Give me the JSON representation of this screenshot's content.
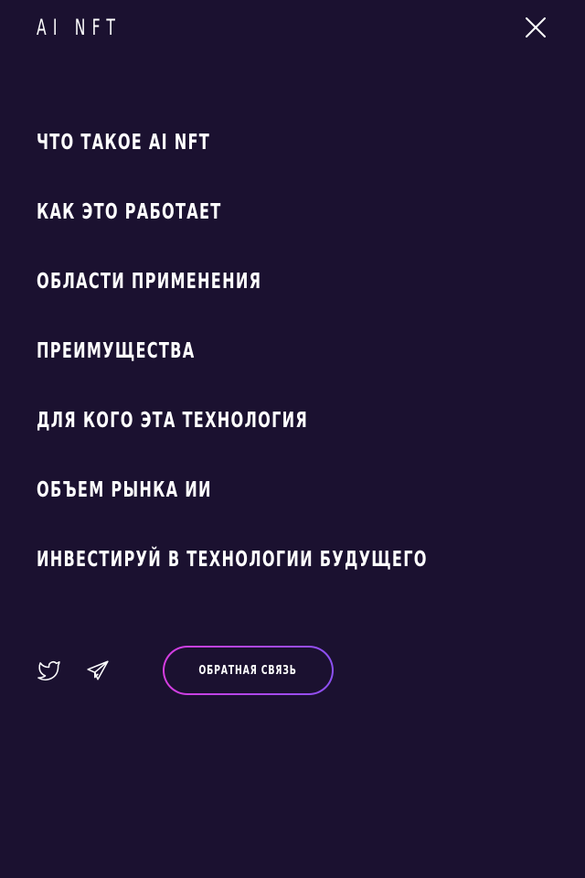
{
  "header": {
    "logo_text": "AI NFT",
    "close_icon": "close-icon"
  },
  "nav": {
    "items": [
      {
        "label": "ЧТО ТАКОЕ AI NFT"
      },
      {
        "label": "КАК ЭТО РАБОТАЕТ"
      },
      {
        "label": "ОБЛАСТИ ПРИМЕНЕНИЯ"
      },
      {
        "label": "ПРЕИМУЩЕСТВА"
      },
      {
        "label": "ДЛЯ КОГО ЭТА ТЕХНОЛОГИЯ"
      },
      {
        "label": "ОБЪЕМ РЫНКА ИИ"
      },
      {
        "label": "ИНВЕСТИРУЙ В ТЕХНОЛОГИИ БУДУЩЕГО"
      }
    ]
  },
  "footer": {
    "social": [
      {
        "icon": "twitter-icon"
      },
      {
        "icon": "telegram-icon"
      }
    ],
    "feedback_label": "ОБРАТНАЯ СВЯЗЬ"
  },
  "colors": {
    "background": "#1b1130",
    "text": "#ffffff",
    "accent_gradient_start": "#d63de0",
    "accent_gradient_end": "#8b50f2"
  }
}
